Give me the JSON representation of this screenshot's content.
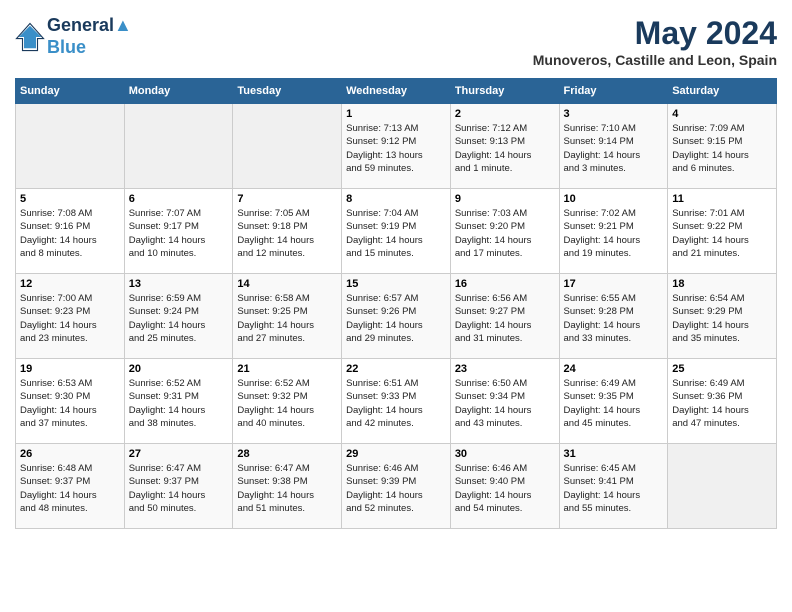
{
  "header": {
    "logo_line1": "General",
    "logo_line2": "Blue",
    "month": "May 2024",
    "location": "Munoveros, Castille and Leon, Spain"
  },
  "weekdays": [
    "Sunday",
    "Monday",
    "Tuesday",
    "Wednesday",
    "Thursday",
    "Friday",
    "Saturday"
  ],
  "weeks": [
    [
      {
        "day": "",
        "info": ""
      },
      {
        "day": "",
        "info": ""
      },
      {
        "day": "",
        "info": ""
      },
      {
        "day": "1",
        "info": "Sunrise: 7:13 AM\nSunset: 9:12 PM\nDaylight: 13 hours\nand 59 minutes."
      },
      {
        "day": "2",
        "info": "Sunrise: 7:12 AM\nSunset: 9:13 PM\nDaylight: 14 hours\nand 1 minute."
      },
      {
        "day": "3",
        "info": "Sunrise: 7:10 AM\nSunset: 9:14 PM\nDaylight: 14 hours\nand 3 minutes."
      },
      {
        "day": "4",
        "info": "Sunrise: 7:09 AM\nSunset: 9:15 PM\nDaylight: 14 hours\nand 6 minutes."
      }
    ],
    [
      {
        "day": "5",
        "info": "Sunrise: 7:08 AM\nSunset: 9:16 PM\nDaylight: 14 hours\nand 8 minutes."
      },
      {
        "day": "6",
        "info": "Sunrise: 7:07 AM\nSunset: 9:17 PM\nDaylight: 14 hours\nand 10 minutes."
      },
      {
        "day": "7",
        "info": "Sunrise: 7:05 AM\nSunset: 9:18 PM\nDaylight: 14 hours\nand 12 minutes."
      },
      {
        "day": "8",
        "info": "Sunrise: 7:04 AM\nSunset: 9:19 PM\nDaylight: 14 hours\nand 15 minutes."
      },
      {
        "day": "9",
        "info": "Sunrise: 7:03 AM\nSunset: 9:20 PM\nDaylight: 14 hours\nand 17 minutes."
      },
      {
        "day": "10",
        "info": "Sunrise: 7:02 AM\nSunset: 9:21 PM\nDaylight: 14 hours\nand 19 minutes."
      },
      {
        "day": "11",
        "info": "Sunrise: 7:01 AM\nSunset: 9:22 PM\nDaylight: 14 hours\nand 21 minutes."
      }
    ],
    [
      {
        "day": "12",
        "info": "Sunrise: 7:00 AM\nSunset: 9:23 PM\nDaylight: 14 hours\nand 23 minutes."
      },
      {
        "day": "13",
        "info": "Sunrise: 6:59 AM\nSunset: 9:24 PM\nDaylight: 14 hours\nand 25 minutes."
      },
      {
        "day": "14",
        "info": "Sunrise: 6:58 AM\nSunset: 9:25 PM\nDaylight: 14 hours\nand 27 minutes."
      },
      {
        "day": "15",
        "info": "Sunrise: 6:57 AM\nSunset: 9:26 PM\nDaylight: 14 hours\nand 29 minutes."
      },
      {
        "day": "16",
        "info": "Sunrise: 6:56 AM\nSunset: 9:27 PM\nDaylight: 14 hours\nand 31 minutes."
      },
      {
        "day": "17",
        "info": "Sunrise: 6:55 AM\nSunset: 9:28 PM\nDaylight: 14 hours\nand 33 minutes."
      },
      {
        "day": "18",
        "info": "Sunrise: 6:54 AM\nSunset: 9:29 PM\nDaylight: 14 hours\nand 35 minutes."
      }
    ],
    [
      {
        "day": "19",
        "info": "Sunrise: 6:53 AM\nSunset: 9:30 PM\nDaylight: 14 hours\nand 37 minutes."
      },
      {
        "day": "20",
        "info": "Sunrise: 6:52 AM\nSunset: 9:31 PM\nDaylight: 14 hours\nand 38 minutes."
      },
      {
        "day": "21",
        "info": "Sunrise: 6:52 AM\nSunset: 9:32 PM\nDaylight: 14 hours\nand 40 minutes."
      },
      {
        "day": "22",
        "info": "Sunrise: 6:51 AM\nSunset: 9:33 PM\nDaylight: 14 hours\nand 42 minutes."
      },
      {
        "day": "23",
        "info": "Sunrise: 6:50 AM\nSunset: 9:34 PM\nDaylight: 14 hours\nand 43 minutes."
      },
      {
        "day": "24",
        "info": "Sunrise: 6:49 AM\nSunset: 9:35 PM\nDaylight: 14 hours\nand 45 minutes."
      },
      {
        "day": "25",
        "info": "Sunrise: 6:49 AM\nSunset: 9:36 PM\nDaylight: 14 hours\nand 47 minutes."
      }
    ],
    [
      {
        "day": "26",
        "info": "Sunrise: 6:48 AM\nSunset: 9:37 PM\nDaylight: 14 hours\nand 48 minutes."
      },
      {
        "day": "27",
        "info": "Sunrise: 6:47 AM\nSunset: 9:37 PM\nDaylight: 14 hours\nand 50 minutes."
      },
      {
        "day": "28",
        "info": "Sunrise: 6:47 AM\nSunset: 9:38 PM\nDaylight: 14 hours\nand 51 minutes."
      },
      {
        "day": "29",
        "info": "Sunrise: 6:46 AM\nSunset: 9:39 PM\nDaylight: 14 hours\nand 52 minutes."
      },
      {
        "day": "30",
        "info": "Sunrise: 6:46 AM\nSunset: 9:40 PM\nDaylight: 14 hours\nand 54 minutes."
      },
      {
        "day": "31",
        "info": "Sunrise: 6:45 AM\nSunset: 9:41 PM\nDaylight: 14 hours\nand 55 minutes."
      },
      {
        "day": "",
        "info": ""
      }
    ]
  ]
}
